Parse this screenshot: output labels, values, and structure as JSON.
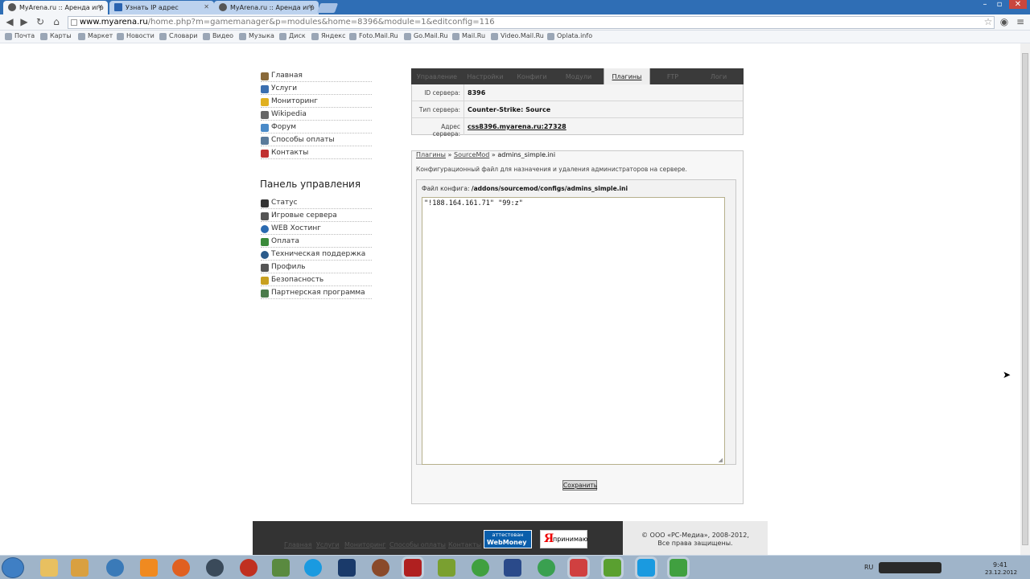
{
  "browser": {
    "tabs": [
      {
        "label": "MyArena.ru :: Аренда игр"
      },
      {
        "label": "Узнать IP адрес"
      },
      {
        "label": "MyArena.ru :: Аренда игр"
      }
    ],
    "url_host": "www.myarena.ru",
    "url_path": "/home.php?m=gamemanager&p=modules&home=8396&module=1&editconfig=116",
    "bookmarks": [
      "Почта",
      "Карты",
      "Маркет",
      "Новости",
      "Словари",
      "Видео",
      "Музыка",
      "Диск",
      "Яндекс",
      "Foto.Mail.Ru",
      "Go.Mail.Ru",
      "Mail.Ru",
      "Video.Mail.Ru",
      "Oplata.info"
    ]
  },
  "sidebar": {
    "nav": [
      {
        "label": "Главная",
        "color": "#8a6a3a"
      },
      {
        "label": "Услуги",
        "color": "#3b6fb0"
      },
      {
        "label": "Мониторинг",
        "color": "#e0b020"
      },
      {
        "label": "Wikipedia",
        "color": "#666666"
      },
      {
        "label": "Форум",
        "color": "#4a8ac8"
      },
      {
        "label": "Способы оплаты",
        "color": "#5a7a9a"
      },
      {
        "label": "Контакты",
        "color": "#c03030"
      }
    ],
    "panel_title": "Панель управления",
    "panel": [
      {
        "label": "Статус",
        "color": "#333333"
      },
      {
        "label": "Игровые сервера",
        "color": "#555555"
      },
      {
        "label": "WEB Хостинг",
        "color": "#2a6ab0"
      },
      {
        "label": "Оплата",
        "color": "#3a8a3a"
      },
      {
        "label": "Техническая поддержка",
        "color": "#2a5a8a"
      },
      {
        "label": "Профиль",
        "color": "#555555"
      },
      {
        "label": "Безопасность",
        "color": "#c8a020"
      },
      {
        "label": "Партнерская программа",
        "color": "#4a7a4a"
      }
    ]
  },
  "server": {
    "tabs": [
      "Управление",
      "Настройки",
      "Конфиги",
      "Модули",
      "Плагины",
      "FTP",
      "Логи"
    ],
    "active_tab": "Плагины",
    "rows": [
      {
        "label": "ID сервера:",
        "value": "8396"
      },
      {
        "label": "Тип сервера:",
        "value": "Counter-Strike: Source"
      },
      {
        "label": "Адрес сервера:",
        "value": "css8396.myarena.ru:27328"
      }
    ]
  },
  "config": {
    "crumb_1": "Плагины",
    "crumb_sep": "»",
    "crumb_2": "SourceMod",
    "crumb_3": "admins_simple.ini",
    "description": "Конфигурационный файл для назначения и удаления администраторов на сервере.",
    "file_label": "Файл конфига:",
    "file_path": "/addons/sourcemod/configs/admins_simple.ini",
    "content": "\"!188.164.161.71\" \"99:z\"",
    "save_label": "Сохранить"
  },
  "footer": {
    "links": [
      "Главная",
      "Услуги",
      "Мониторинг",
      "Способы оплаты",
      "Контакты"
    ],
    "wm_top": "аттестован",
    "wm_bottom": "WebMoney",
    "ya_letter": "Я",
    "ya_text": "принимаю",
    "copyright": "© ООО «РС-Медиа», 2008-2012,",
    "rights": "Все права защищены."
  },
  "taskbar": {
    "lang": "RU",
    "time": "9:41",
    "date": "23.12.2012"
  }
}
